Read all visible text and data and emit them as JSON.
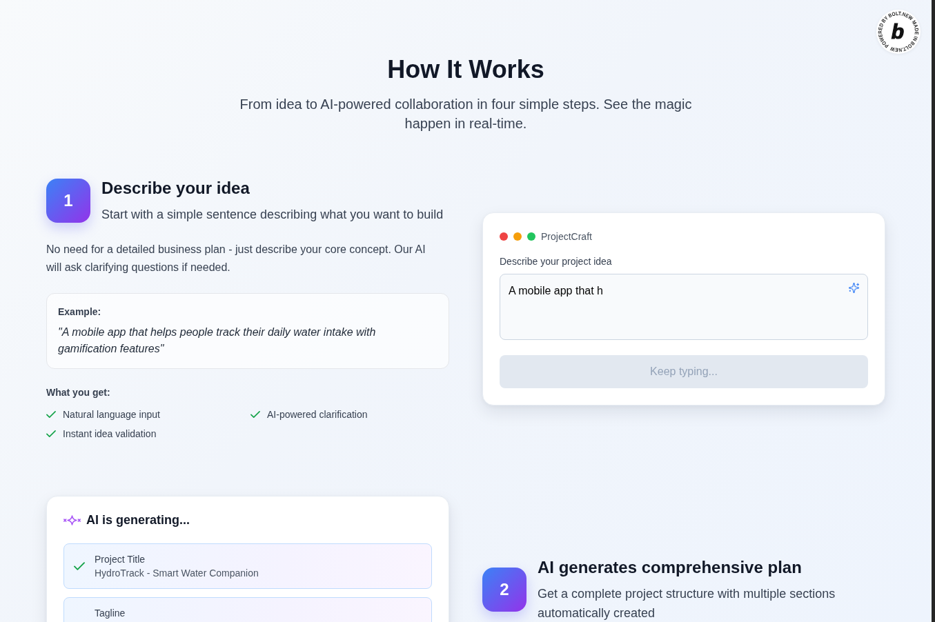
{
  "badge": {
    "ring_text": "POWERED BY BOLT.NEW MADE IN BOLT.NEW",
    "letter": "b"
  },
  "header": {
    "title": "How It Works",
    "subtitle": "From idea to AI-powered collaboration in four simple steps. See the magic happen in real-time."
  },
  "steps": [
    {
      "number": "1",
      "title": "Describe your idea",
      "subtitle": "Start with a simple sentence describing what you want to build",
      "description": "No need for a detailed business plan - just describe your core concept. Our AI will ask clarifying questions if needed.",
      "example": {
        "label": "Example:",
        "text": "\"A mobile app that helps people track their daily water intake with gamification features\""
      },
      "features": {
        "heading": "What you get:",
        "items": [
          "Natural language input",
          "AI-powered clarification",
          "Instant idea validation"
        ]
      },
      "demo": {
        "kind": "input",
        "window_dots": [
          {
            "color": "#ef4444"
          },
          {
            "color": "#f59e0b"
          },
          {
            "color": "#22c55e"
          }
        ],
        "app_name": "ProjectCraft",
        "field_label": "Describe your project idea",
        "field_value": "A mobile app that h",
        "button": {
          "label": "Keep typing...",
          "disabled": true
        }
      }
    },
    {
      "number": "2",
      "title": "AI generates comprehensive plan",
      "subtitle": "Get a complete project structure with multiple sections automatically created",
      "demo": {
        "kind": "generating",
        "heading": "AI is generating...",
        "sections": [
          {
            "label": "Project Title",
            "value": "HydroTrack - Smart Water Companion",
            "done": true
          },
          {
            "label": "Tagline"
          }
        ]
      }
    }
  ]
}
